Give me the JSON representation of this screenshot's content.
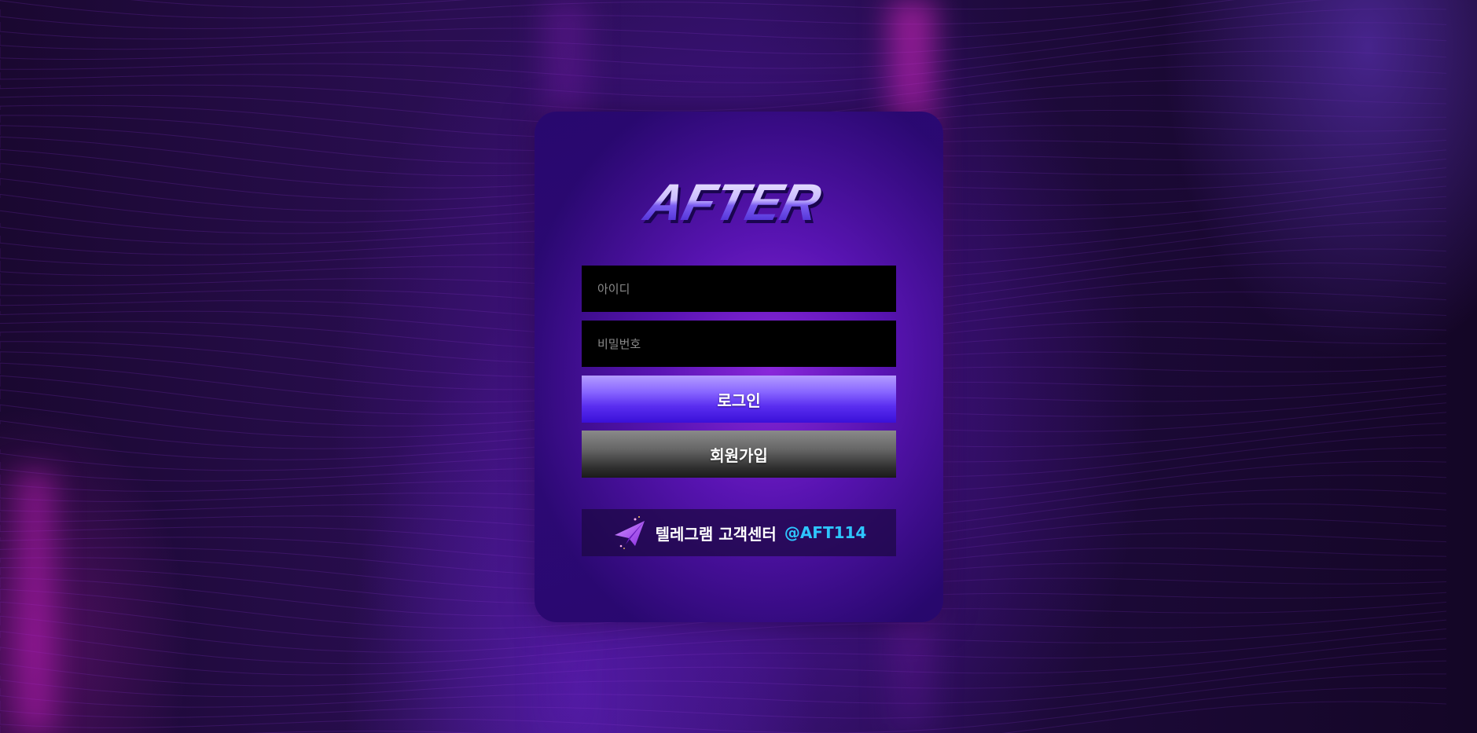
{
  "brand": {
    "logo_text": "AFTER"
  },
  "login_form": {
    "id_placeholder": "아이디",
    "password_placeholder": "비밀번호",
    "login_label": "로그인",
    "signup_label": "회원가입"
  },
  "support": {
    "label": "텔레그램 고객센터",
    "handle": "@AFT114",
    "icon": "paper-plane-icon"
  },
  "colors": {
    "accent_purple": "#5a2ef0",
    "handle_blue": "#2ec6ff",
    "card_purple": "#5a14b8"
  }
}
